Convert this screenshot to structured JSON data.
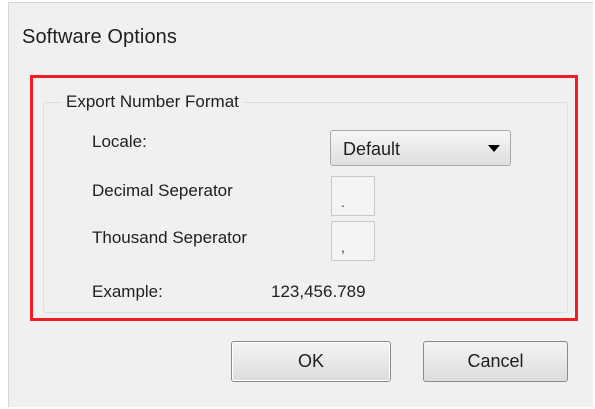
{
  "dialog": {
    "title": "Software Options"
  },
  "group": {
    "legend": "Export Number Format",
    "locale": {
      "label": "Locale:",
      "selected": "Default"
    },
    "decimal_separator": {
      "label": "Decimal Seperator",
      "value": "."
    },
    "thousand_separator": {
      "label": "Thousand Seperator",
      "value": ","
    },
    "example": {
      "label": "Example:",
      "value": "123,456.789"
    }
  },
  "buttons": {
    "ok_label": "OK",
    "cancel_label": "Cancel"
  },
  "colors": {
    "highlight": "#ee1c24",
    "dialog_background": "#f0f0f0"
  },
  "icons": {
    "dropdown": "chevron-down-icon"
  }
}
